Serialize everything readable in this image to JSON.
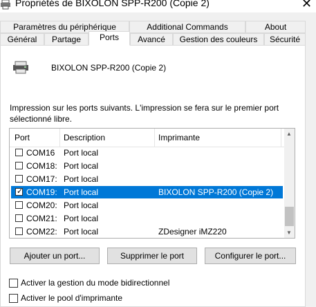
{
  "window": {
    "title": "Propriétés de BIXOLON SPP-R200 (Copie 2)"
  },
  "tabs_row1": [
    {
      "label": "Paramètres du périphérique"
    },
    {
      "label": "Additional Commands"
    },
    {
      "label": "About"
    }
  ],
  "tabs_row2": [
    {
      "label": "Général"
    },
    {
      "label": "Partage"
    },
    {
      "label": "Ports"
    },
    {
      "label": "Avancé"
    },
    {
      "label": "Gestion des couleurs"
    },
    {
      "label": "Sécurité"
    }
  ],
  "printer": {
    "name": "BIXOLON SPP-R200 (Copie 2)",
    "icon": "printer-icon"
  },
  "description": "Impression sur les ports suivants. L'impression se fera sur le premier port sélectionné libre.",
  "ports": {
    "headers": {
      "port": "Port",
      "description": "Description",
      "printer": "Imprimante"
    },
    "rows": [
      {
        "port": "COM16",
        "description": "Port local",
        "printer": "",
        "checked": false,
        "selected": false
      },
      {
        "port": "COM18:",
        "description": "Port local",
        "printer": "",
        "checked": false,
        "selected": false
      },
      {
        "port": "COM17:",
        "description": "Port local",
        "printer": "",
        "checked": false,
        "selected": false
      },
      {
        "port": "COM19:",
        "description": "Port local",
        "printer": "BIXOLON SPP-R200 (Copie 2)",
        "checked": true,
        "selected": true
      },
      {
        "port": "COM20:",
        "description": "Port local",
        "printer": "",
        "checked": false,
        "selected": false
      },
      {
        "port": "COM21:",
        "description": "Port local",
        "printer": "",
        "checked": false,
        "selected": false
      },
      {
        "port": "COM22:",
        "description": "Port local",
        "printer": "ZDesigner iMZ220",
        "checked": false,
        "selected": false
      }
    ]
  },
  "buttons": {
    "add": "Ajouter un port...",
    "remove": "Supprimer le port",
    "configure": "Configurer le port..."
  },
  "options": {
    "bidirectional": "Activer la gestion du mode bidirectionnel",
    "pool": "Activer le pool d'imprimante"
  },
  "colors": {
    "selection": "#0078d7"
  }
}
